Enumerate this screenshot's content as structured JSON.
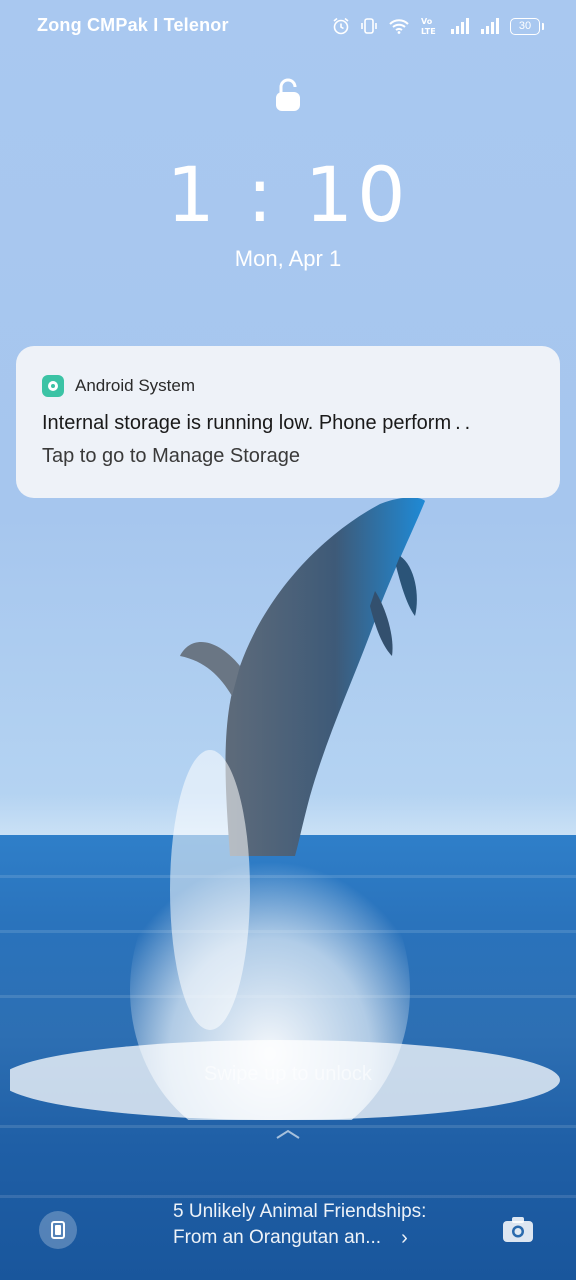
{
  "status_bar": {
    "carrier": "Zong CMPak I Telenor",
    "battery": "30",
    "icons": [
      "alarm-icon",
      "vibrate-icon",
      "wifi-icon",
      "volte-icon",
      "signal-icon",
      "signal-icon",
      "battery-icon"
    ]
  },
  "lockscreen": {
    "time": "1 : 10",
    "date": "Mon, Apr 1",
    "swipe_hint": "Swipe up to unlock"
  },
  "notification": {
    "app_name": "Android System",
    "title": "Internal storage is running low. Phone perform . .",
    "body": "Tap to go to Manage Storage",
    "accent": "#3bc3a5"
  },
  "story": {
    "line1": "5 Unlikely Animal Friendships:",
    "line2": "From an Orangutan an...",
    "chevron": "›"
  },
  "colors": {
    "sky": "#a9c8f0",
    "sea": "#2a73bc"
  }
}
